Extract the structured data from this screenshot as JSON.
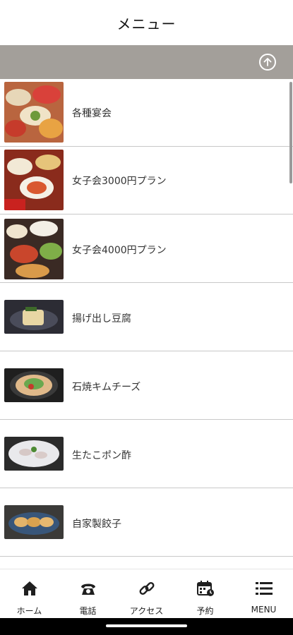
{
  "header": {
    "title": "メニュー"
  },
  "menu_items": [
    {
      "label": "各種宴会"
    },
    {
      "label": "女子会3000円プラン"
    },
    {
      "label": "女子会4000円プラン"
    },
    {
      "label": "揚げ出し豆腐"
    },
    {
      "label": "石焼キムチーズ"
    },
    {
      "label": "生たこポン酢"
    },
    {
      "label": "自家製餃子"
    }
  ],
  "tabs": [
    {
      "label": "ホーム",
      "icon": "home-icon"
    },
    {
      "label": "電話",
      "icon": "phone-icon"
    },
    {
      "label": "アクセス",
      "icon": "link-icon"
    },
    {
      "label": "予約",
      "icon": "calendar-icon"
    },
    {
      "label": "MENU",
      "icon": "menu-list-icon"
    }
  ],
  "colors": {
    "subbar": "#a39f9a",
    "divider": "#c8c8c8",
    "system_bar": "#000000"
  }
}
